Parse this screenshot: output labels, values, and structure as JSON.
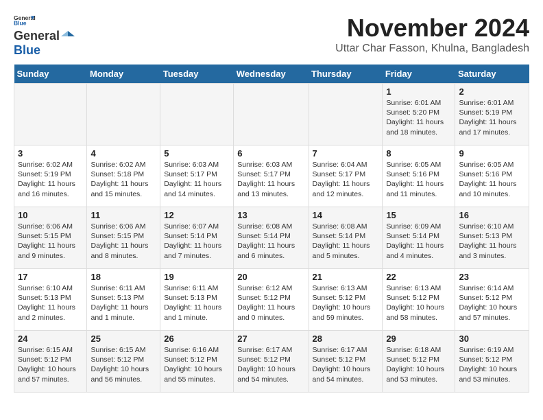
{
  "logo": {
    "general": "General",
    "blue": "Blue"
  },
  "title": "November 2024",
  "location": "Uttar Char Fasson, Khulna, Bangladesh",
  "weekdays": [
    "Sunday",
    "Monday",
    "Tuesday",
    "Wednesday",
    "Thursday",
    "Friday",
    "Saturday"
  ],
  "weeks": [
    [
      {
        "day": "",
        "info": ""
      },
      {
        "day": "",
        "info": ""
      },
      {
        "day": "",
        "info": ""
      },
      {
        "day": "",
        "info": ""
      },
      {
        "day": "",
        "info": ""
      },
      {
        "day": "1",
        "info": "Sunrise: 6:01 AM\nSunset: 5:20 PM\nDaylight: 11 hours and 18 minutes."
      },
      {
        "day": "2",
        "info": "Sunrise: 6:01 AM\nSunset: 5:19 PM\nDaylight: 11 hours and 17 minutes."
      }
    ],
    [
      {
        "day": "3",
        "info": "Sunrise: 6:02 AM\nSunset: 5:19 PM\nDaylight: 11 hours and 16 minutes."
      },
      {
        "day": "4",
        "info": "Sunrise: 6:02 AM\nSunset: 5:18 PM\nDaylight: 11 hours and 15 minutes."
      },
      {
        "day": "5",
        "info": "Sunrise: 6:03 AM\nSunset: 5:17 PM\nDaylight: 11 hours and 14 minutes."
      },
      {
        "day": "6",
        "info": "Sunrise: 6:03 AM\nSunset: 5:17 PM\nDaylight: 11 hours and 13 minutes."
      },
      {
        "day": "7",
        "info": "Sunrise: 6:04 AM\nSunset: 5:17 PM\nDaylight: 11 hours and 12 minutes."
      },
      {
        "day": "8",
        "info": "Sunrise: 6:05 AM\nSunset: 5:16 PM\nDaylight: 11 hours and 11 minutes."
      },
      {
        "day": "9",
        "info": "Sunrise: 6:05 AM\nSunset: 5:16 PM\nDaylight: 11 hours and 10 minutes."
      }
    ],
    [
      {
        "day": "10",
        "info": "Sunrise: 6:06 AM\nSunset: 5:15 PM\nDaylight: 11 hours and 9 minutes."
      },
      {
        "day": "11",
        "info": "Sunrise: 6:06 AM\nSunset: 5:15 PM\nDaylight: 11 hours and 8 minutes."
      },
      {
        "day": "12",
        "info": "Sunrise: 6:07 AM\nSunset: 5:14 PM\nDaylight: 11 hours and 7 minutes."
      },
      {
        "day": "13",
        "info": "Sunrise: 6:08 AM\nSunset: 5:14 PM\nDaylight: 11 hours and 6 minutes."
      },
      {
        "day": "14",
        "info": "Sunrise: 6:08 AM\nSunset: 5:14 PM\nDaylight: 11 hours and 5 minutes."
      },
      {
        "day": "15",
        "info": "Sunrise: 6:09 AM\nSunset: 5:14 PM\nDaylight: 11 hours and 4 minutes."
      },
      {
        "day": "16",
        "info": "Sunrise: 6:10 AM\nSunset: 5:13 PM\nDaylight: 11 hours and 3 minutes."
      }
    ],
    [
      {
        "day": "17",
        "info": "Sunrise: 6:10 AM\nSunset: 5:13 PM\nDaylight: 11 hours and 2 minutes."
      },
      {
        "day": "18",
        "info": "Sunrise: 6:11 AM\nSunset: 5:13 PM\nDaylight: 11 hours and 1 minute."
      },
      {
        "day": "19",
        "info": "Sunrise: 6:11 AM\nSunset: 5:13 PM\nDaylight: 11 hours and 1 minute."
      },
      {
        "day": "20",
        "info": "Sunrise: 6:12 AM\nSunset: 5:12 PM\nDaylight: 11 hours and 0 minutes."
      },
      {
        "day": "21",
        "info": "Sunrise: 6:13 AM\nSunset: 5:12 PM\nDaylight: 10 hours and 59 minutes."
      },
      {
        "day": "22",
        "info": "Sunrise: 6:13 AM\nSunset: 5:12 PM\nDaylight: 10 hours and 58 minutes."
      },
      {
        "day": "23",
        "info": "Sunrise: 6:14 AM\nSunset: 5:12 PM\nDaylight: 10 hours and 57 minutes."
      }
    ],
    [
      {
        "day": "24",
        "info": "Sunrise: 6:15 AM\nSunset: 5:12 PM\nDaylight: 10 hours and 57 minutes."
      },
      {
        "day": "25",
        "info": "Sunrise: 6:15 AM\nSunset: 5:12 PM\nDaylight: 10 hours and 56 minutes."
      },
      {
        "day": "26",
        "info": "Sunrise: 6:16 AM\nSunset: 5:12 PM\nDaylight: 10 hours and 55 minutes."
      },
      {
        "day": "27",
        "info": "Sunrise: 6:17 AM\nSunset: 5:12 PM\nDaylight: 10 hours and 54 minutes."
      },
      {
        "day": "28",
        "info": "Sunrise: 6:17 AM\nSunset: 5:12 PM\nDaylight: 10 hours and 54 minutes."
      },
      {
        "day": "29",
        "info": "Sunrise: 6:18 AM\nSunset: 5:12 PM\nDaylight: 10 hours and 53 minutes."
      },
      {
        "day": "30",
        "info": "Sunrise: 6:19 AM\nSunset: 5:12 PM\nDaylight: 10 hours and 53 minutes."
      }
    ]
  ]
}
